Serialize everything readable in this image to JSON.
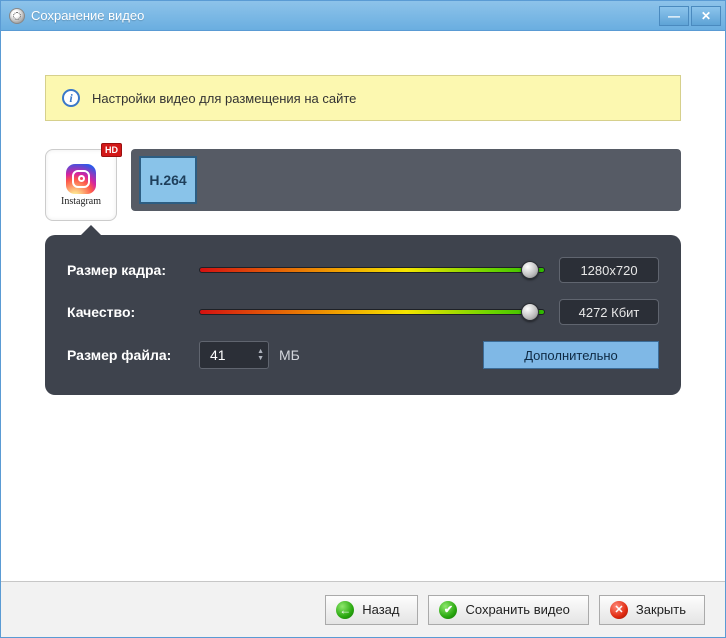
{
  "window": {
    "title": "Сохранение видео"
  },
  "banner": {
    "text": "Настройки видео для размещения на сайте"
  },
  "preset": {
    "name": "Instagram",
    "hd_badge": "HD",
    "codec": "H.264"
  },
  "settings": {
    "frame_size": {
      "label": "Размер кадра:",
      "value": "1280x720",
      "slider_pct": 96
    },
    "quality": {
      "label": "Качество:",
      "value": "4272 Кбит",
      "slider_pct": 96
    },
    "file_size": {
      "label": "Размер файла:",
      "value": "41",
      "unit": "МБ"
    },
    "advanced_label": "Дополнительно"
  },
  "footer": {
    "back": "Назад",
    "save": "Сохранить видео",
    "close": "Закрыть"
  }
}
